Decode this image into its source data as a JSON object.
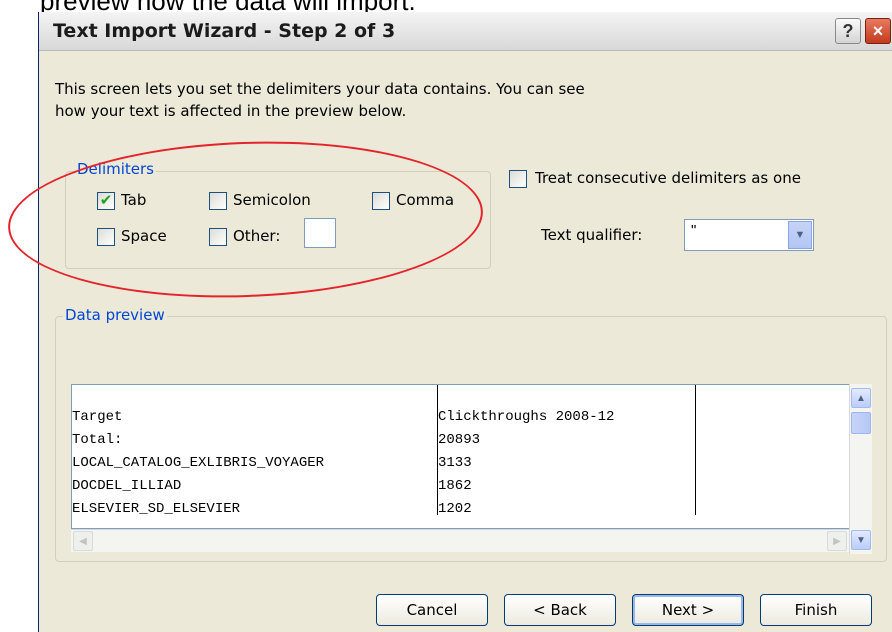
{
  "page_caption": "preview how the data will import.",
  "window": {
    "title": "Text Import Wizard - Step 2 of 3",
    "help_glyph": "?",
    "close_glyph": "×"
  },
  "intro_line1": "This screen lets you set the delimiters your data contains.  You can see",
  "intro_line2": "how your text is affected in the preview below.",
  "delimiters": {
    "group_label": "Delimiters",
    "tab": {
      "label": "Tab",
      "checked": true
    },
    "semicolon": {
      "label": "Semicolon",
      "checked": false
    },
    "comma": {
      "label": "Comma",
      "checked": false
    },
    "space": {
      "label": "Space",
      "checked": false
    },
    "other": {
      "label": "Other:",
      "checked": false,
      "value": ""
    }
  },
  "treat_consecutive": {
    "label": "Treat consecutive delimiters as one",
    "checked": false
  },
  "text_qualifier": {
    "label": "Text qualifier:",
    "value": "\""
  },
  "data_preview": {
    "group_label": "Data preview",
    "rows": [
      [
        "Target",
        "Clickthroughs 2008-12"
      ],
      [
        "Total:",
        "20893"
      ],
      [
        "LOCAL_CATALOG_EXLIBRIS_VOYAGER",
        "3133"
      ],
      [
        "DOCDEL_ILLIAD",
        "1862"
      ],
      [
        "ELSEVIER_SD_ELSEVIER",
        "1202"
      ]
    ]
  },
  "buttons": {
    "cancel": "Cancel",
    "back": "< Back",
    "next": "Next >",
    "finish": "Finish"
  },
  "annotation_color": "#e4232a"
}
